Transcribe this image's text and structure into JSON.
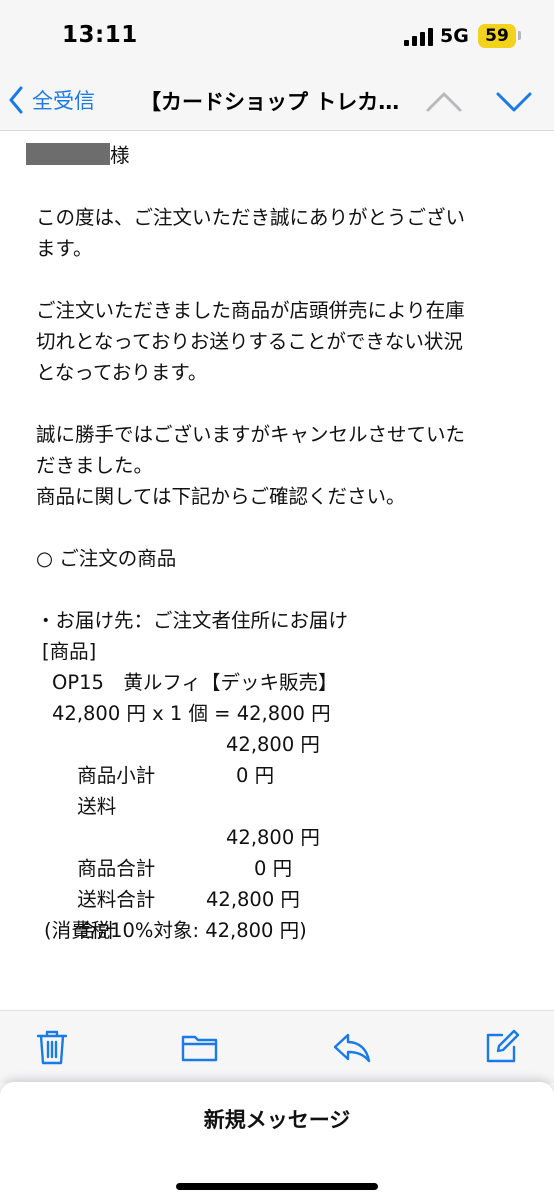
{
  "status_bar": {
    "time": "13:11",
    "network": "5G",
    "battery": "59"
  },
  "nav": {
    "back_label": "全受信",
    "title": "【カードショップ トレカ…"
  },
  "email": {
    "recipient_suffix": "様",
    "intro": [
      "この度は、ご注文いただき誠にありがとうござい",
      "ます。"
    ],
    "paragraph1": [
      "ご注文いただきました商品が店頭併売により在庫",
      "切れとなっておりお送りすることができない状況",
      "となっております。"
    ],
    "paragraph2": [
      "誠に勝手ではございますがキャンセルさせていた",
      "だきました。",
      "商品に関しては下記からご確認ください。"
    ],
    "section_heading": "○ ご注文の商品",
    "delivery": "・お届け先：ご注文者住所にお届け",
    "product_label": "[商品]",
    "product_name": "OP15　黄ルフィ【デッキ販売】",
    "product_price_line": "42,800 円 x 1 個 = 42,800 円",
    "subtotal": {
      "label": "商品小計",
      "value": "42,800 円"
    },
    "shipping": {
      "label": "送料",
      "value": "0 円"
    },
    "product_total": {
      "label": "商品合計",
      "value": "42,800 円"
    },
    "shipping_total": {
      "label": "送料合計",
      "value": "0 円"
    },
    "grand_total": {
      "label": "合計",
      "value": "42,800 円"
    },
    "tax_note": "(消費税10%対象: 42,800 円)"
  },
  "toolbar": {
    "icons": [
      "trash-icon",
      "folder-icon",
      "reply-icon",
      "compose-icon"
    ],
    "accent": "#1a7ae6"
  },
  "sheet": {
    "title": "新規メッセージ"
  }
}
